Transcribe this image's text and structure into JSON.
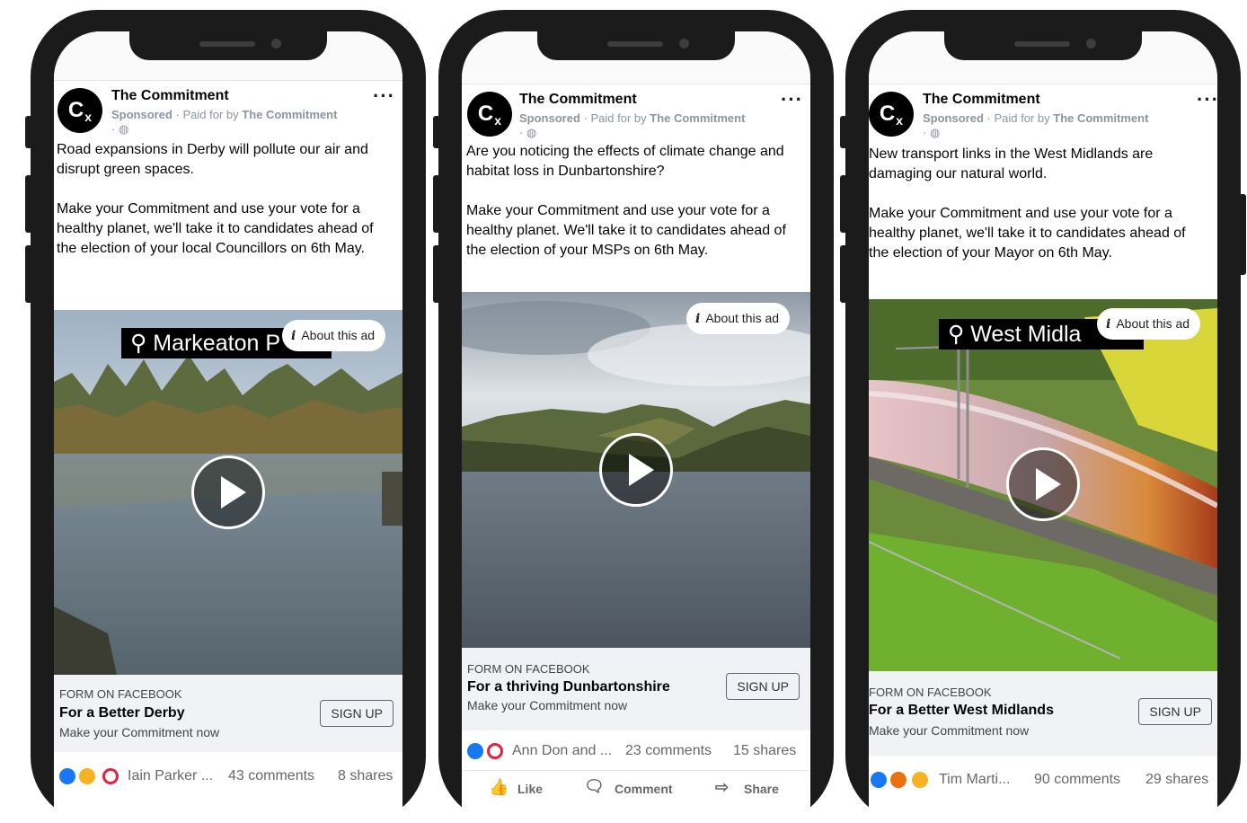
{
  "ads": [
    {
      "page_name": "The Commitment",
      "avatar_text": "C",
      "avatar_sub": "x",
      "sponsored": "Sponsored",
      "paid_for": "· Paid for by",
      "paid_by": "The Commitment",
      "globe": "· ◍",
      "more": "···",
      "text": "Road expansions in Derby will pollute our air and disrupt green spaces.\n\nMake your Commitment and use your vote for a healthy planet, we'll take it to candidates ahead of the election of your local Councillors on 6th May.",
      "location_tag": "⚲ Markeaton P",
      "about_ad": "About this ad",
      "cta_source": "FORM ON FACEBOOK",
      "cta_title": "For a Better Derby",
      "cta_sub": "Make your Commitment now",
      "signup": "SIGN UP",
      "reaction_names": "Iain Parker ...",
      "comments": "43 comments",
      "shares": "8 shares"
    },
    {
      "page_name": "The Commitment",
      "avatar_text": "C",
      "avatar_sub": "x",
      "sponsored": "Sponsored",
      "paid_for": "· Paid for by",
      "paid_by": "The Commitment",
      "globe": "· ◍",
      "more": "···",
      "text": "Are you noticing the effects of climate change and habitat loss in Dunbartonshire?\n\nMake your Commitment and use your vote for a healthy planet. We'll take it to candidates ahead of the election of your MSPs on 6th May.",
      "about_ad": "About this ad",
      "cta_source": "FORM ON FACEBOOK",
      "cta_title": "For a thriving Dunbartonshire",
      "cta_sub": "Make your Commitment now",
      "signup": "SIGN UP",
      "reaction_names": "Ann Don and ...",
      "comments": "23 comments",
      "shares": "15 shares",
      "actions": {
        "like": "Like",
        "comment": "Comment",
        "share": "Share"
      }
    },
    {
      "page_name": "The Commitment",
      "avatar_text": "C",
      "avatar_sub": "x",
      "sponsored": "Sponsored",
      "paid_for": "· Paid for by",
      "paid_by": "The Commitment",
      "globe": "· ◍",
      "more": "···",
      "text": "New transport links in the West Midlands are damaging our natural world.\n\nMake your Commitment and use your vote for a healthy planet, we'll take it to candidates ahead of the election of your Mayor on 6th May.",
      "location_tag": "⚲ West Midla",
      "about_ad": "About this ad",
      "cta_source": "FORM ON FACEBOOK",
      "cta_title": "For a Better West Midlands",
      "cta_sub": "Make your Commitment now",
      "signup": "SIGN UP",
      "reaction_names": "Tim Marti...",
      "comments": "90 comments",
      "shares": "29 shares"
    }
  ]
}
